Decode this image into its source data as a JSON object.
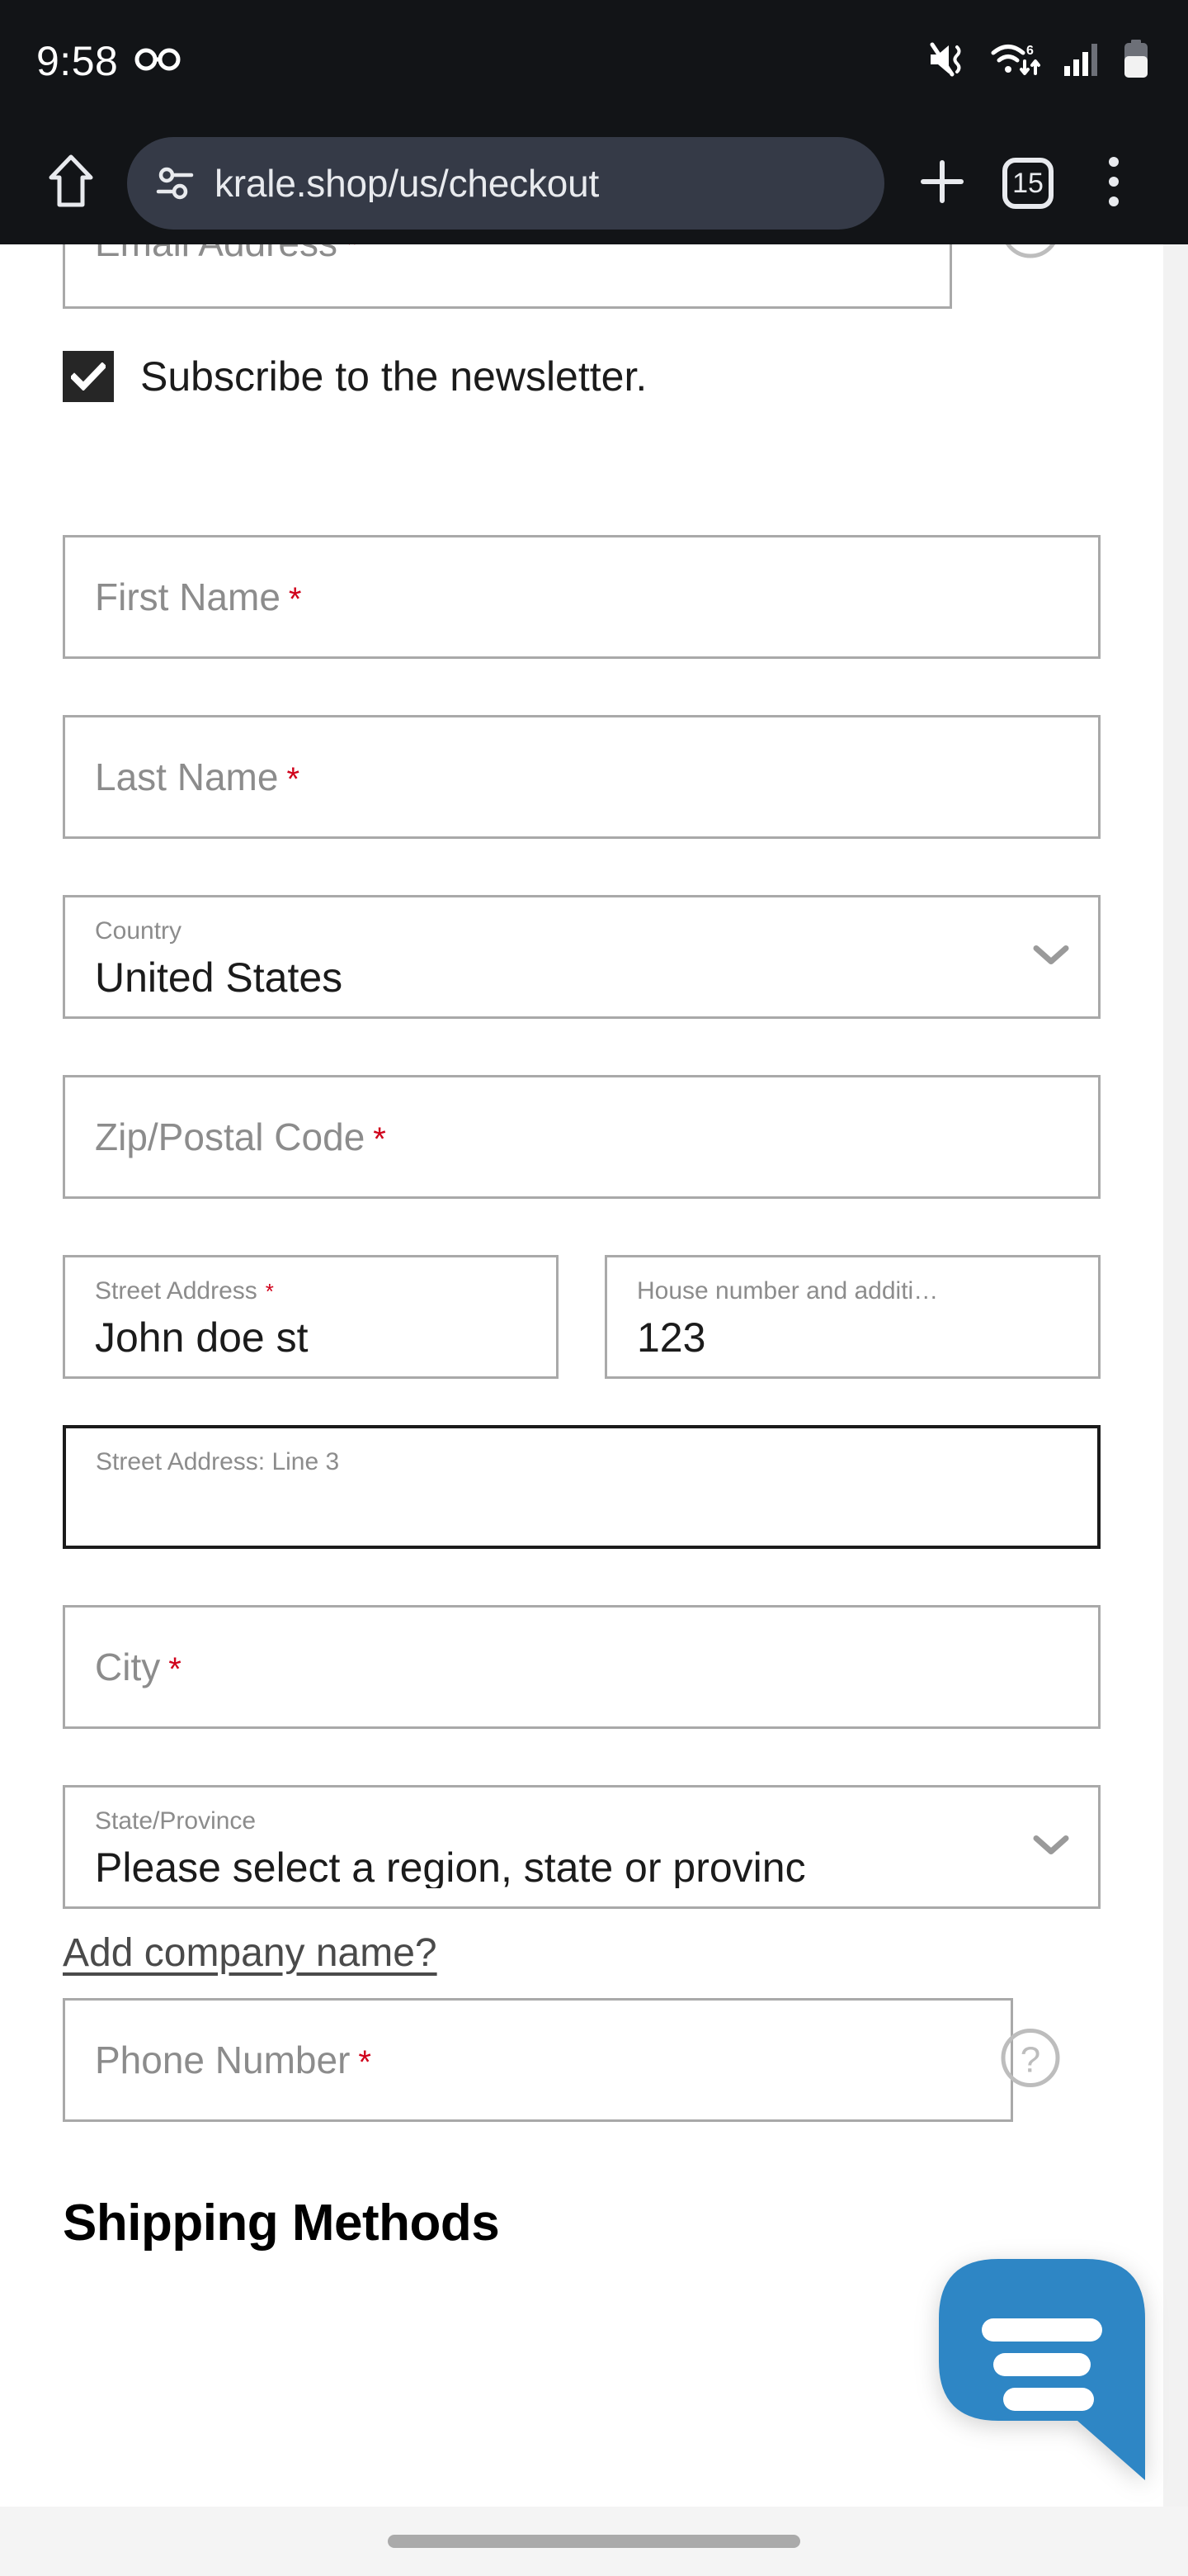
{
  "status_bar": {
    "time": "9:58",
    "icons": {
      "glasses": "glasses-icon",
      "volume_muted": "volume-muted-vibrate-icon",
      "wifi": "wifi-6-data-icon",
      "wifi_label": "6",
      "cellular": "cellular-signal-icon",
      "battery": "battery-icon"
    }
  },
  "browser": {
    "home_icon": "home-icon",
    "url_permissions_icon": "site-permissions-icon",
    "url": "krale.shop/us/checkout",
    "new_tab_icon": "plus-icon",
    "tab_count": "15",
    "menu_icon": "more-vertical-icon"
  },
  "form": {
    "email": {
      "placeholder": "Email Address",
      "required": "*",
      "value": "",
      "help_icon": "help-circle-icon"
    },
    "newsletter": {
      "label": "Subscribe to the newsletter.",
      "checked": true
    },
    "first_name": {
      "placeholder": "First Name",
      "required": "*",
      "value": ""
    },
    "last_name": {
      "placeholder": "Last Name",
      "required": "*",
      "value": ""
    },
    "country": {
      "label": "Country",
      "value": "United States",
      "chevron_icon": "chevron-down-icon"
    },
    "zip": {
      "placeholder": "Zip/Postal Code",
      "required": "*",
      "value": ""
    },
    "street_address": {
      "label": "Street Address",
      "required": "*",
      "value": "John doe st"
    },
    "house_number": {
      "label": "House number and additi…",
      "value": "123"
    },
    "street_line3": {
      "label": "Street Address: Line 3",
      "value": "",
      "focused": true
    },
    "city": {
      "placeholder": "City",
      "required": "*",
      "value": ""
    },
    "state": {
      "label": "State/Province",
      "value": "Please select a region, state or provinc",
      "chevron_icon": "chevron-down-icon"
    },
    "company_link": "Add company name?",
    "phone": {
      "placeholder": "Phone Number",
      "required": "*",
      "value": "",
      "help_icon": "help-circle-icon"
    }
  },
  "sections": {
    "shipping_methods": "Shipping Methods"
  },
  "chat": {
    "icon": "chat-bubble-icon",
    "color": "#2E86C5"
  },
  "colors": {
    "chrome_bg": "#121417",
    "url_pill": "#353a47",
    "required_red": "#d0021b",
    "field_border": "#a9a9a9",
    "field_border_focused": "#1b1b1b",
    "chat_blue": "#2E86C5",
    "page_bg": "#ffffff"
  }
}
